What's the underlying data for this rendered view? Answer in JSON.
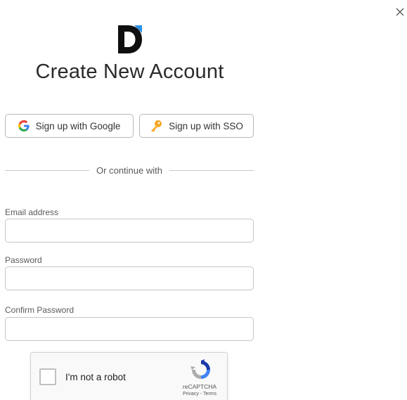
{
  "icons": {
    "close": "close-icon",
    "logo": "brand-d-logo",
    "google": "google-g-icon",
    "sso": "key-icon",
    "recaptcha": "recaptcha-icon"
  },
  "colors": {
    "logo_dark": "#0f0f0f",
    "logo_accent": "#2f8fe6",
    "key_orange": "#f5a623",
    "border": "#c6c6c6"
  },
  "title": "Create New Account",
  "buttons": {
    "google_label": "Sign up with Google",
    "sso_label": "Sign up with SSO"
  },
  "divider_text": "Or continue with",
  "form": {
    "email": {
      "label": "Email address",
      "value": ""
    },
    "password": {
      "label": "Password",
      "value": ""
    },
    "confirm_password": {
      "label": "Confirm Password",
      "value": ""
    }
  },
  "captcha": {
    "label": "I'm not a robot",
    "brand": "reCAPTCHA",
    "privacy": "Privacy",
    "separator": " - ",
    "terms": "Terms"
  }
}
